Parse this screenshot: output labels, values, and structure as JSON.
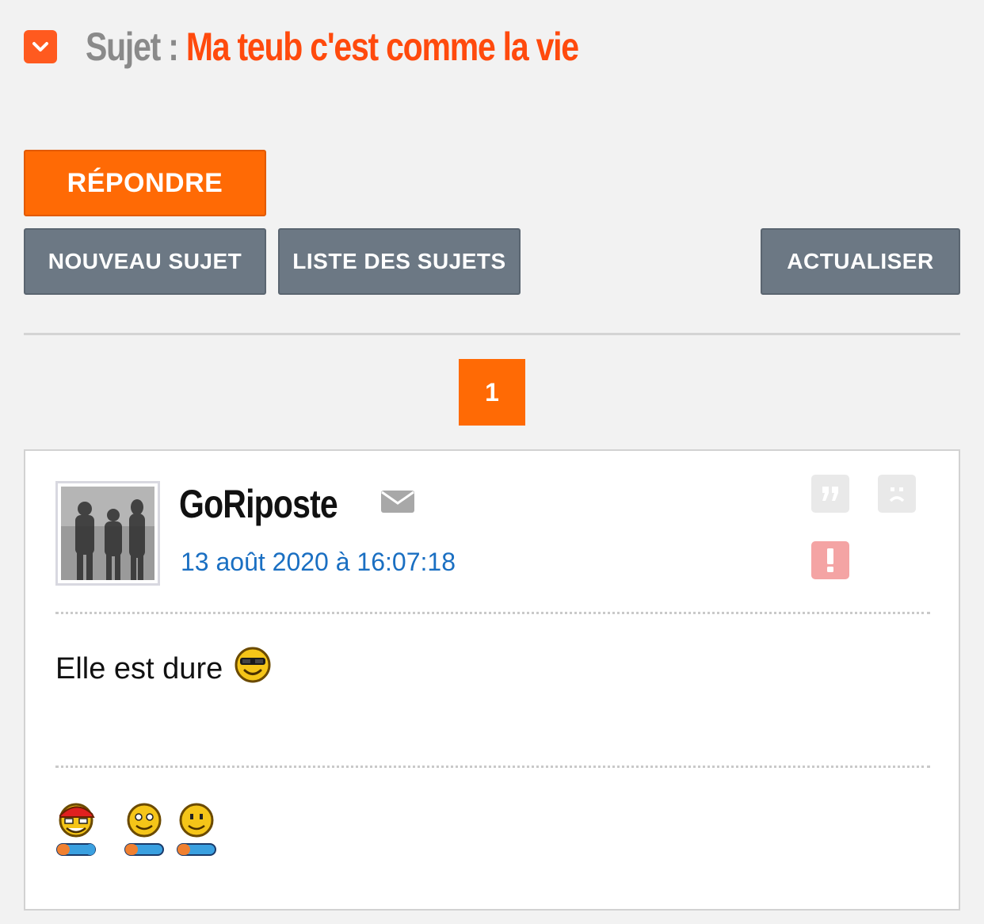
{
  "header": {
    "prefix": "Sujet : ",
    "title": "Ma teub c'est comme la vie",
    "collapse_icon": "chevron-down-icon"
  },
  "buttons": {
    "reply": "RÉPONDRE",
    "new_topic": "NOUVEAU SUJET",
    "topic_list": "LISTE DES SUJETS",
    "refresh": "ACTUALISER"
  },
  "pagination": {
    "current": "1"
  },
  "post": {
    "author": "GoRiposte",
    "date": "13 août 2020 à 16:07:18",
    "body": "Elle est dure",
    "body_smiley": "cool-sunglasses-smiley",
    "signature_smileys": [
      "gamer-cap-smiley",
      "gamer-smiley",
      "gamer-smiley"
    ],
    "icons": {
      "mail": "mail-icon",
      "quote": "quote-icon",
      "sad": "sad-face-icon",
      "alert": "alert-icon"
    }
  },
  "colors": {
    "accent": "#ff6a05",
    "title": "#ff4a0d",
    "grey_button": "#6c7884",
    "date_link": "#1a6fc2",
    "alert": "#f4a4a4"
  }
}
